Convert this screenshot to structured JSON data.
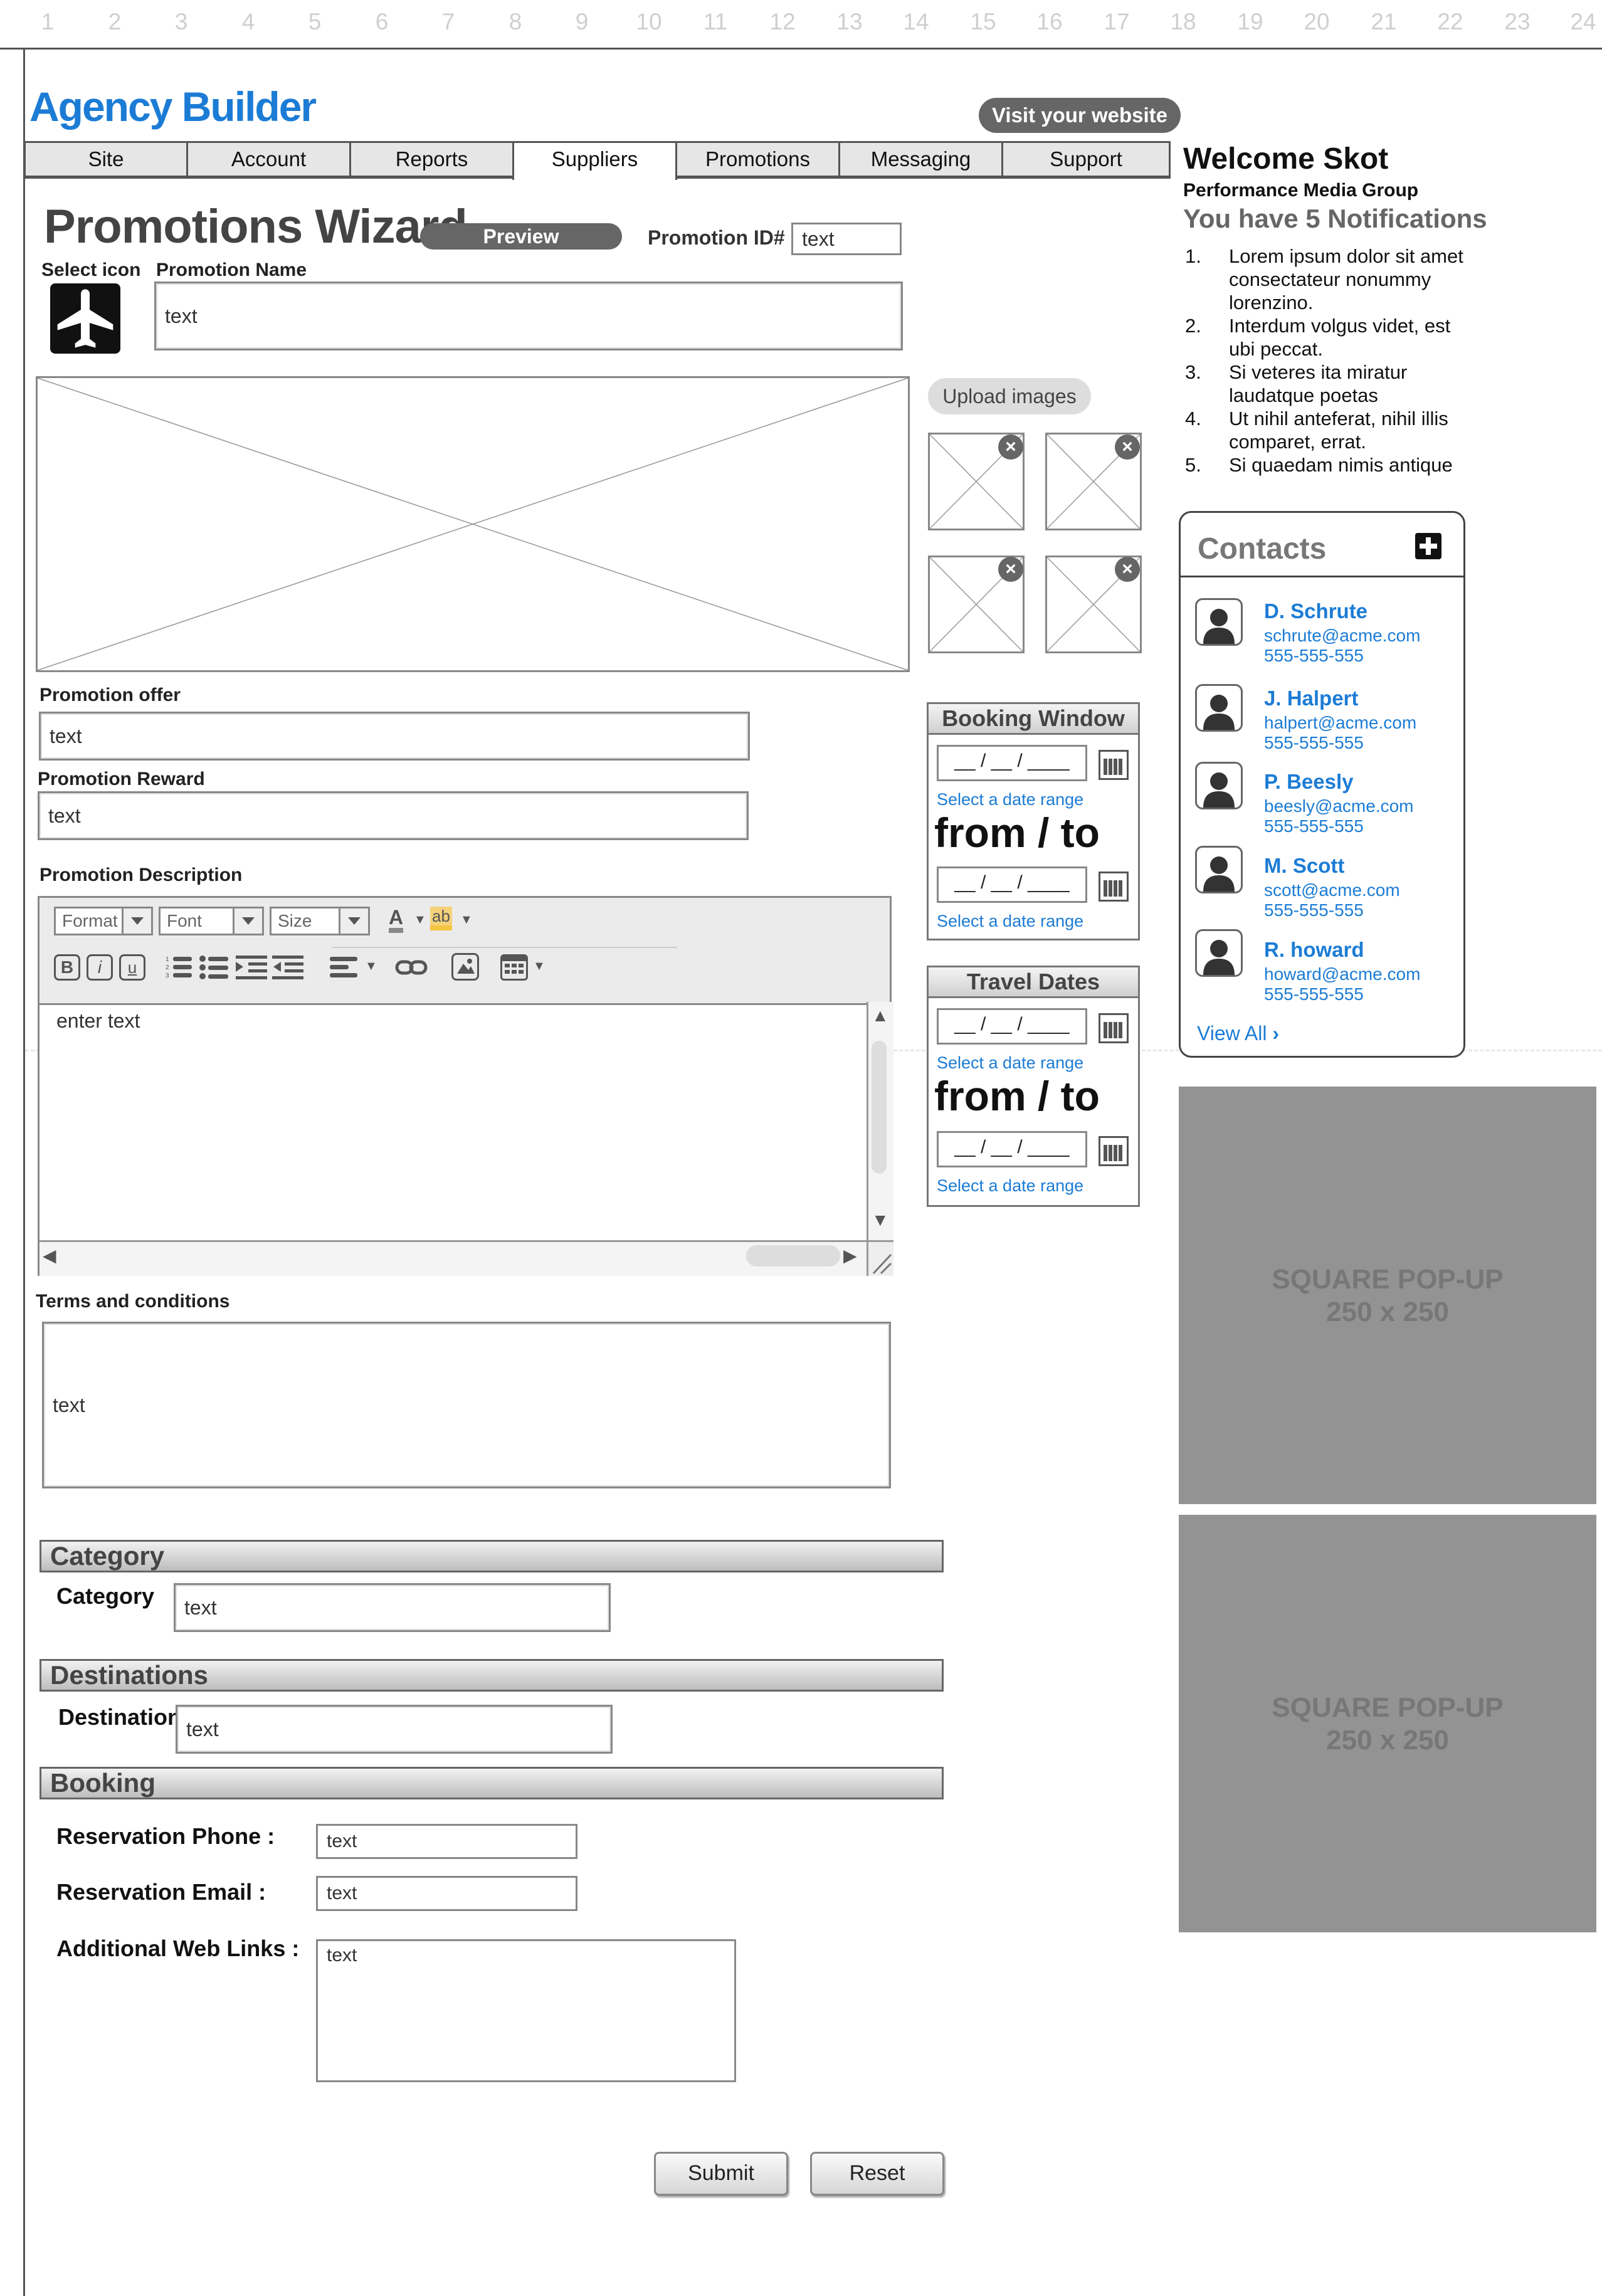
{
  "ruler": [
    "1",
    "2",
    "3",
    "4",
    "5",
    "6",
    "7",
    "8",
    "9",
    "10",
    "11",
    "12",
    "13",
    "14",
    "15",
    "16",
    "17",
    "18",
    "19",
    "20",
    "21",
    "22",
    "23",
    "24"
  ],
  "header": {
    "app_title": "Agency Builder",
    "visit_label": "Visit your website"
  },
  "tabs": [
    {
      "label": "Site"
    },
    {
      "label": "Account"
    },
    {
      "label": "Reports"
    },
    {
      "label": "Suppliers",
      "active": true
    },
    {
      "label": "Promotions"
    },
    {
      "label": "Messaging"
    },
    {
      "label": "Support"
    }
  ],
  "wizard": {
    "title": "Promotions Wizard",
    "preview_label": "Preview",
    "promo_id_label": "Promotion ID#",
    "promo_id_value": "text",
    "select_icon_label": "Select icon",
    "promo_name_label": "Promotion Name",
    "promo_name_value": "text",
    "upload_label": "Upload images",
    "offer_label": "Promotion offer",
    "offer_value": "text",
    "reward_label": "Promotion Reward",
    "reward_value": "text",
    "description_label": "Promotion Description",
    "editor": {
      "format": "Format",
      "font": "Font",
      "size": "Size",
      "text_color_glyph": "A",
      "highlight_glyph": "ab",
      "body_text": "enter text"
    },
    "terms_label": "Terms and conditions",
    "terms_value": "text"
  },
  "booking_window": {
    "title": "Booking Window",
    "date_placeholder": "__ / __ / ____",
    "hint": "Select a date range",
    "from_to": "from / to"
  },
  "travel_dates": {
    "title": "Travel Dates",
    "date_placeholder": "__ / __ / ____",
    "hint": "Select a date range",
    "from_to": "from / to"
  },
  "category": {
    "section": "Category",
    "label": "Category",
    "value": "text"
  },
  "destinations": {
    "section": "Destinations",
    "label": "Destination",
    "value": "text"
  },
  "booking": {
    "section": "Booking",
    "phone_label": "Reservation Phone :",
    "phone_value": "text",
    "email_label": "Reservation Email :",
    "email_value": "text",
    "links_label": "Additional Web Links :",
    "links_value": "text"
  },
  "actions": {
    "submit": "Submit",
    "reset": "Reset"
  },
  "sidebar": {
    "welcome": "Welcome Skot",
    "company": "Performance Media Group",
    "notifications_title": "You have 5 Notifications",
    "notifications": [
      {
        "num": "1.",
        "text": "Lorem ipsum dolor sit amet consectateur nonummy lorenzino."
      },
      {
        "num": "2.",
        "text": "Interdum volgus videt, est ubi peccat."
      },
      {
        "num": "3.",
        "text": "Si veteres ita miratur laudatque poetas"
      },
      {
        "num": "4.",
        "text": "Ut nihil anteferat, nihil illis comparet, errat."
      },
      {
        "num": "5.",
        "text": "Si quaedam nimis antique"
      }
    ],
    "contacts_title": "Contacts",
    "contacts": [
      {
        "name": "D. Schrute",
        "email": "schrute@acme.com",
        "phone": "555-555-555"
      },
      {
        "name": "J. Halpert",
        "email": "halpert@acme.com",
        "phone": "555-555-555"
      },
      {
        "name": "P. Beesly",
        "email": "beesly@acme.com",
        "phone": "555-555-555"
      },
      {
        "name": "M. Scott",
        "email": "scott@acme.com",
        "phone": "555-555-555"
      },
      {
        "name": "R. howard",
        "email": "howard@acme.com",
        "phone": "555-555-555"
      }
    ],
    "view_all": "View All",
    "popup1": {
      "line1": "SQUARE POP-UP",
      "line2": "250 x 250"
    },
    "popup2": {
      "line1": "SQUARE POP-UP",
      "line2": "250 x 250"
    }
  },
  "colors": {
    "accent": "#1c7cd5",
    "popup_bg": "#939393",
    "border": "#888888"
  }
}
